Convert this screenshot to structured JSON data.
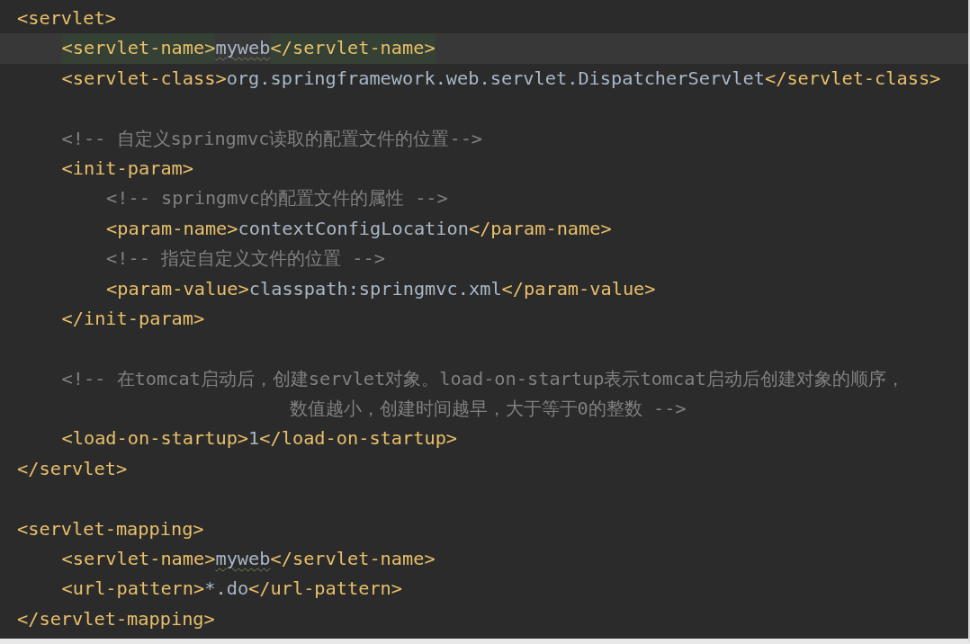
{
  "code": [
    {
      "kind": "code",
      "current": false,
      "tokens": [
        {
          "kind": "tag",
          "text": "<servlet>"
        }
      ],
      "children": [
        {
          "kind": "code",
          "current": true,
          "tokens": [
            {
              "kind": "tag",
              "text": "<servlet-name>",
              "matched": true
            },
            {
              "kind": "text",
              "text": "myweb",
              "typo": true
            },
            {
              "kind": "tag",
              "text": "</servlet-name>",
              "matched": true
            }
          ]
        },
        {
          "kind": "code",
          "current": false,
          "tokens": [
            {
              "kind": "tag",
              "text": "<servlet-class>"
            },
            {
              "kind": "text",
              "text": "org.springframework.web.servlet.DispatcherServlet"
            },
            {
              "kind": "tag",
              "text": "</servlet-class>"
            }
          ]
        },
        {
          "kind": "blank"
        },
        {
          "kind": "code",
          "current": false,
          "tokens": [
            {
              "kind": "comment",
              "text": "<!-- 自定义springmvc读取的配置文件的位置-->"
            }
          ]
        },
        {
          "kind": "code",
          "current": false,
          "tokens": [
            {
              "kind": "tag",
              "text": "<init-param>"
            }
          ],
          "children": [
            {
              "kind": "code",
              "current": false,
              "tokens": [
                {
                  "kind": "comment",
                  "text": "<!-- springmvc的配置文件的属性 -->"
                }
              ]
            },
            {
              "kind": "code",
              "current": false,
              "tokens": [
                {
                  "kind": "tag",
                  "text": "<param-name>"
                },
                {
                  "kind": "text",
                  "text": "contextConfigLocation"
                },
                {
                  "kind": "tag",
                  "text": "</param-name>"
                }
              ]
            },
            {
              "kind": "code",
              "current": false,
              "tokens": [
                {
                  "kind": "comment",
                  "text": "<!-- 指定自定义文件的位置 -->"
                }
              ]
            },
            {
              "kind": "code",
              "current": false,
              "tokens": [
                {
                  "kind": "tag",
                  "text": "<param-value>"
                },
                {
                  "kind": "text",
                  "text": "classpath:springmvc.xml"
                },
                {
                  "kind": "tag",
                  "text": "</param-value>"
                }
              ]
            }
          ]
        },
        {
          "kind": "code",
          "current": false,
          "tokens": [
            {
              "kind": "tag",
              "text": "</init-param>"
            }
          ]
        },
        {
          "kind": "blank"
        },
        {
          "kind": "code",
          "current": false,
          "tokens": [
            {
              "kind": "comment",
              "text": "<!-- 在tomcat启动后，创建servlet对象。load-on-startup表示tomcat启动后创建对象的顺序，"
            }
          ]
        },
        {
          "kind": "continuation",
          "current": false,
          "tokens": [
            {
              "kind": "comment",
              "text": "数值越小，创建时间越早，大于等于0的整数 -->"
            }
          ]
        },
        {
          "kind": "code",
          "current": false,
          "tokens": [
            {
              "kind": "tag",
              "text": "<load-on-startup>"
            },
            {
              "kind": "text",
              "text": "1"
            },
            {
              "kind": "tag",
              "text": "</load-on-startup>"
            }
          ]
        }
      ]
    },
    {
      "kind": "code",
      "current": false,
      "tokens": [
        {
          "kind": "tag",
          "text": "</servlet>"
        }
      ]
    },
    {
      "kind": "blank"
    },
    {
      "kind": "code",
      "current": false,
      "tokens": [
        {
          "kind": "tag",
          "text": "<servlet-mapping>"
        }
      ],
      "children": [
        {
          "kind": "code",
          "current": false,
          "tokens": [
            {
              "kind": "tag",
              "text": "<servlet-name>"
            },
            {
              "kind": "text",
              "text": "myweb",
              "typo": true
            },
            {
              "kind": "tag",
              "text": "</servlet-name>"
            }
          ]
        },
        {
          "kind": "code",
          "current": false,
          "tokens": [
            {
              "kind": "tag",
              "text": "<url-pattern>"
            },
            {
              "kind": "text",
              "text": "*.do"
            },
            {
              "kind": "tag",
              "text": "</url-pattern>"
            }
          ]
        }
      ]
    },
    {
      "kind": "code",
      "current": false,
      "tokens": [
        {
          "kind": "tag",
          "text": "</servlet-mapping>"
        }
      ]
    }
  ]
}
